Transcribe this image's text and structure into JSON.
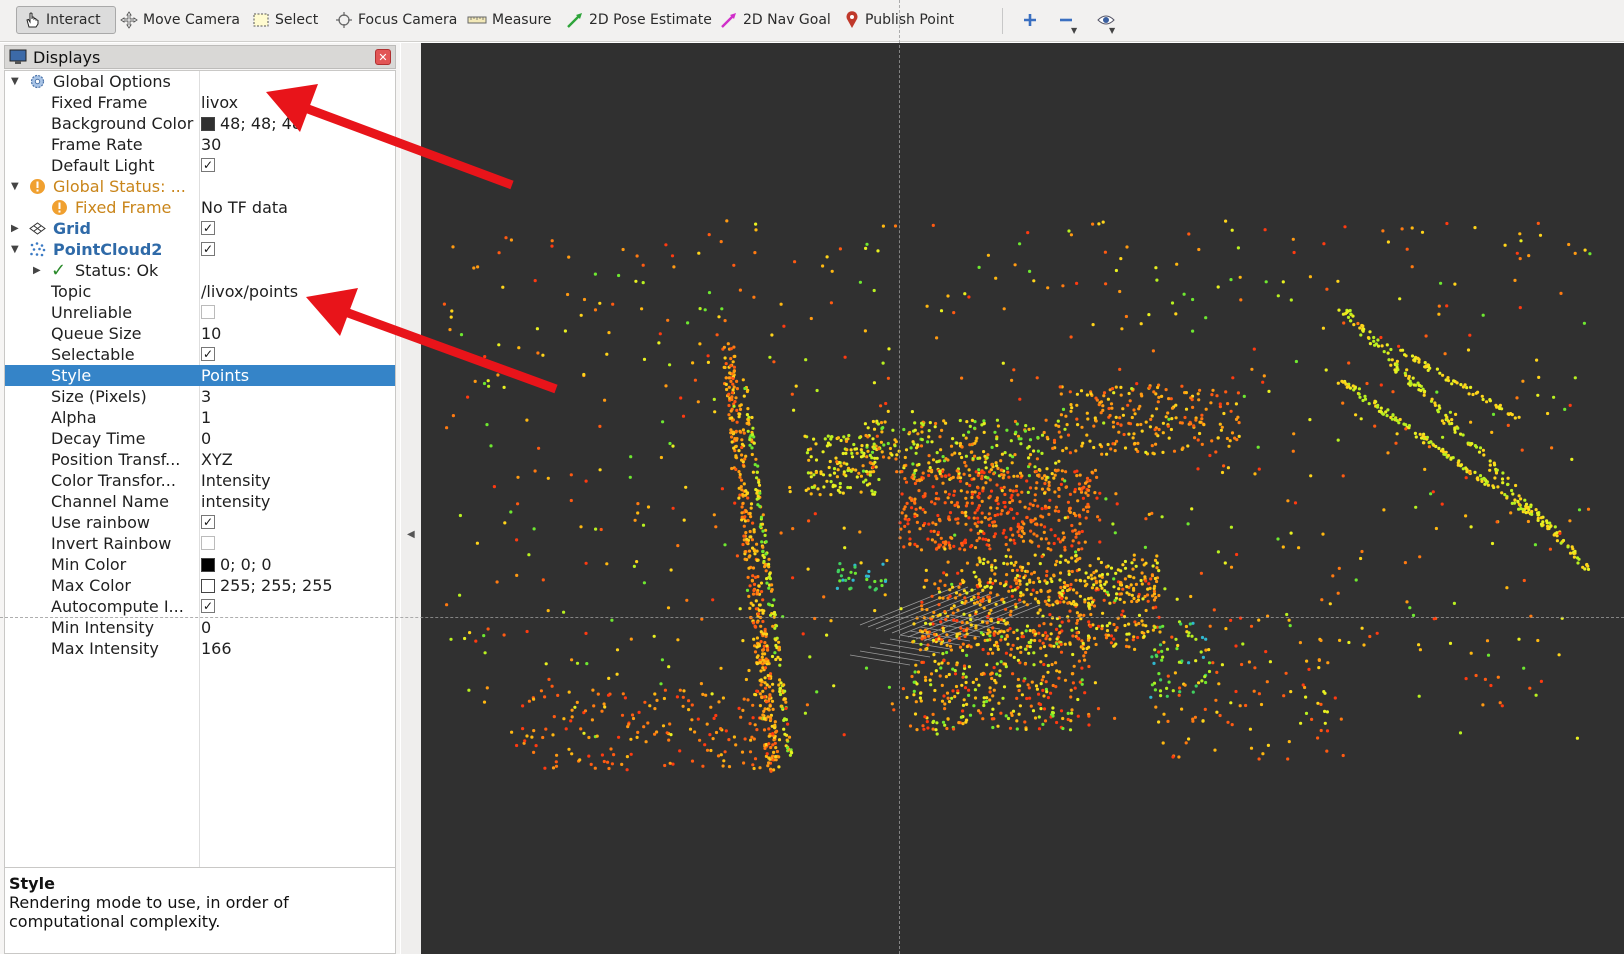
{
  "toolbar": {
    "tools": [
      {
        "label": "Interact",
        "icon": "hand-pointer-icon",
        "active": true
      },
      {
        "label": "Move Camera",
        "icon": "move-camera-icon"
      },
      {
        "label": "Select",
        "icon": "select-rect-icon"
      },
      {
        "label": "Focus Camera",
        "icon": "focus-camera-icon"
      },
      {
        "label": "Measure",
        "icon": "ruler-icon"
      },
      {
        "label": "2D Pose Estimate",
        "icon": "green-arrow-icon",
        "color": "#2ea43a"
      },
      {
        "label": "2D Nav Goal",
        "icon": "magenta-arrow-icon",
        "color": "#d02fc9"
      },
      {
        "label": "Publish Point",
        "icon": "map-pin-icon",
        "color": "#c0392b"
      }
    ],
    "extra_icons": [
      "plus-icon",
      "minus-icon",
      "eye-icon"
    ]
  },
  "displays": {
    "title": "Displays",
    "rows": {
      "global_options": "Global Options",
      "fixed_frame_label": "Fixed Frame",
      "fixed_frame_value": "livox",
      "bg_color_label": "Background Color",
      "bg_color_value": "48; 48; 48",
      "frame_rate_label": "Frame Rate",
      "frame_rate_value": "30",
      "default_light_label": "Default Light",
      "global_status": "Global Status: ...",
      "status_fixed_frame_label": "Fixed Frame",
      "status_fixed_frame_value": "No TF data",
      "grid": "Grid",
      "pointcloud2": "PointCloud2",
      "status_ok": "Status: Ok",
      "topic_label": "Topic",
      "topic_value": "/livox/points",
      "unreliable_label": "Unreliable",
      "queue_size_label": "Queue Size",
      "queue_size_value": "10",
      "selectable_label": "Selectable",
      "style_label": "Style",
      "style_value": "Points",
      "size_label": "Size (Pixels)",
      "size_value": "3",
      "alpha_label": "Alpha",
      "alpha_value": "1",
      "decay_label": "Decay Time",
      "decay_value": "0",
      "position_label": "Position Transf...",
      "position_value": "XYZ",
      "color_transform_label": "Color Transfor...",
      "color_transform_value": "Intensity",
      "channel_label": "Channel Name",
      "channel_value": "intensity",
      "use_rainbow_label": "Use rainbow",
      "invert_rainbow_label": "Invert Rainbow",
      "min_color_label": "Min Color",
      "min_color_value": "0; 0; 0",
      "max_color_label": "Max Color",
      "max_color_value": "255; 255; 255",
      "autocompute_label": "Autocompute I...",
      "min_intensity_label": "Min Intensity",
      "min_intensity_value": "0",
      "max_intensity_label": "Max Intensity",
      "max_intensity_value": "166"
    },
    "checks": {
      "default_light": true,
      "grid": true,
      "pointcloud2": true,
      "unreliable": false,
      "selectable": true,
      "use_rainbow": true,
      "invert_rainbow": false,
      "autocompute": true
    },
    "colors": {
      "background": "#303030",
      "min_color": "#000000",
      "max_color": "#ffffff",
      "selection": "#3584c8",
      "warning": "#c9851a"
    }
  },
  "help": {
    "title": "Style",
    "text": "Rendering mode to use, in order of computational complexity."
  },
  "view": {
    "background": "#303030",
    "annotation_color": "#e8141a"
  }
}
